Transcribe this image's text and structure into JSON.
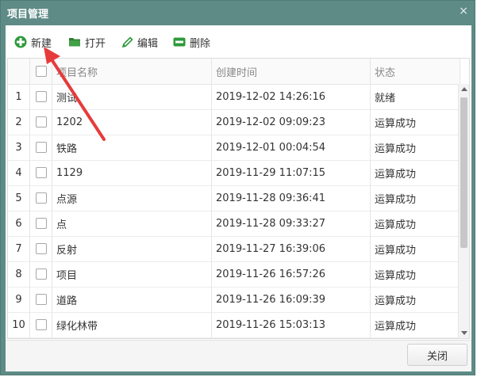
{
  "window": {
    "title": "项目管理",
    "close_glyph": "×"
  },
  "toolbar": {
    "new_label": "新建",
    "open_label": "打开",
    "edit_label": "编辑",
    "delete_label": "删除"
  },
  "grid": {
    "columns": [
      "项目名称",
      "创建时间",
      "状态"
    ],
    "rows": [
      {
        "num": "1",
        "name": "测试",
        "time": "2019-12-02 14:26:16",
        "status": "就绪"
      },
      {
        "num": "2",
        "name": "1202",
        "time": "2019-12-02 09:09:23",
        "status": "运算成功"
      },
      {
        "num": "3",
        "name": "铁路",
        "time": "2019-12-01 00:04:54",
        "status": "运算成功"
      },
      {
        "num": "4",
        "name": "1129",
        "time": "2019-11-29 11:07:15",
        "status": "运算成功"
      },
      {
        "num": "5",
        "name": "点源",
        "time": "2019-11-28 09:36:41",
        "status": "运算成功"
      },
      {
        "num": "6",
        "name": "点",
        "time": "2019-11-28 09:33:27",
        "status": "运算成功"
      },
      {
        "num": "7",
        "name": "反射",
        "time": "2019-11-27 16:39:06",
        "status": "运算成功"
      },
      {
        "num": "8",
        "name": "项目",
        "time": "2019-11-26 16:57:26",
        "status": "运算成功"
      },
      {
        "num": "9",
        "name": "道路",
        "time": "2019-11-26 16:09:39",
        "status": "运算成功"
      },
      {
        "num": "10",
        "name": "绿化林带",
        "time": "2019-11-26 15:03:13",
        "status": "运算成功"
      }
    ]
  },
  "footer": {
    "close_label": "关闭"
  },
  "colors": {
    "title_bar": "#5e8b86",
    "annotation_arrow": "#e63b3b",
    "icon_green": "#2e9a3a"
  }
}
